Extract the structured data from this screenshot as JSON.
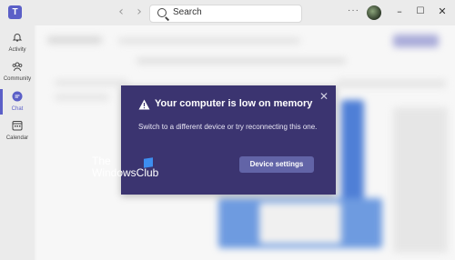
{
  "app": {
    "logo_glyph": "T",
    "accent": "#5b5fc7"
  },
  "titlebar": {
    "search": {
      "label": "Search"
    },
    "more_glyph": "···",
    "back_glyph": "‹",
    "forward_glyph": "›",
    "window": {
      "minimize": "–",
      "maximize": "☐",
      "close": "✕"
    }
  },
  "rail": {
    "items": [
      {
        "label": "Activity",
        "icon": "bell-icon"
      },
      {
        "label": "Community",
        "icon": "community-icon"
      },
      {
        "label": "Chat",
        "icon": "chat-icon",
        "active": true
      },
      {
        "label": "Calendar",
        "icon": "calendar-icon"
      }
    ]
  },
  "dialog": {
    "title": "Your computer is low on memory",
    "message": "Switch to a different device or try reconnecting this one.",
    "button_label": "Device settings",
    "close_glyph": "✕",
    "background": "#3b3470",
    "button_color": "#6264a7"
  },
  "watermark": {
    "line1": "The",
    "line2": "WindowsClub"
  }
}
